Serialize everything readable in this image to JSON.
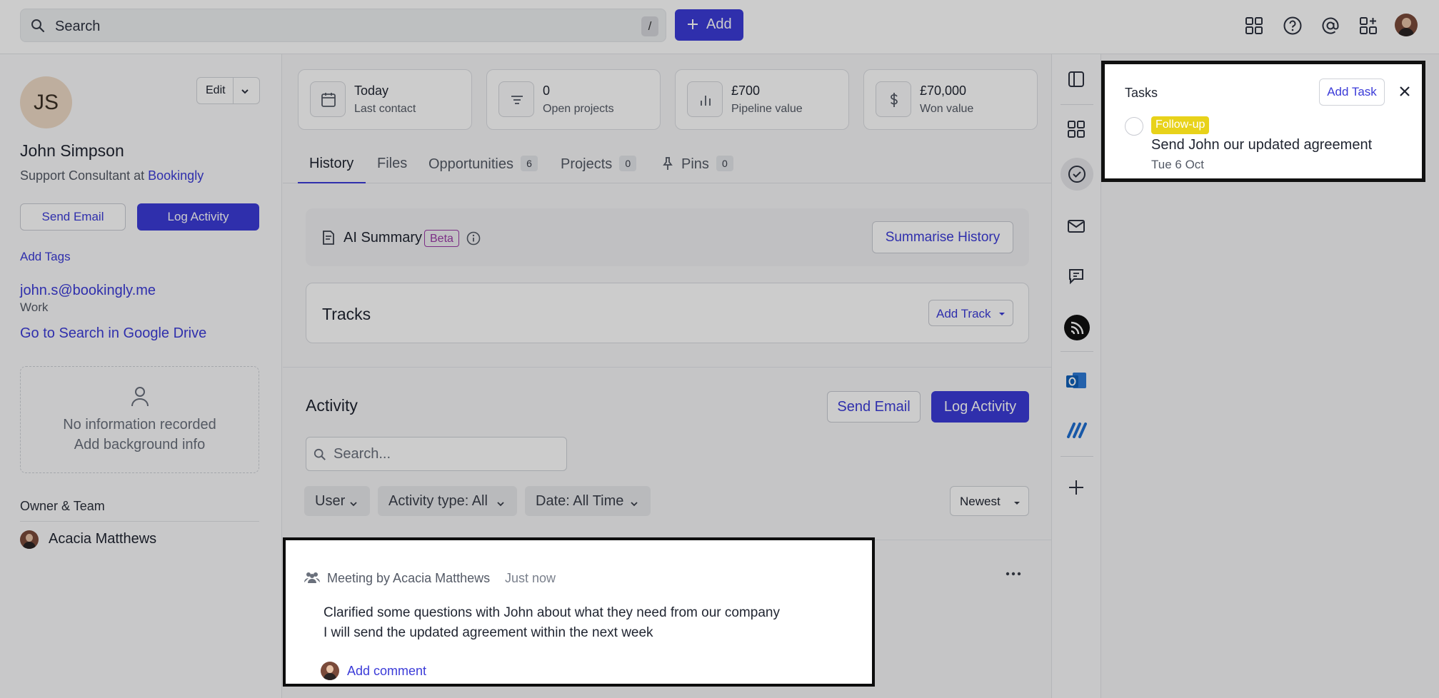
{
  "topbar": {
    "search_placeholder": "Search",
    "search_shortcut": "/",
    "add_label": "Add"
  },
  "contact": {
    "initials": "JS",
    "edit_label": "Edit",
    "name": "John Simpson",
    "role_prefix": "Support Consultant at",
    "company": "Bookingly",
    "send_email": "Send Email",
    "log_activity": "Log Activity",
    "add_tags": "Add Tags",
    "email": "john.s@bookingly.me",
    "email_type": "Work",
    "drive_link": "Go to Search in Google Drive",
    "no_info": "No information recorded",
    "add_background": "Add background info",
    "owner_heading": "Owner & Team",
    "owner_name": "Acacia Matthews"
  },
  "stats": [
    {
      "value": "Today",
      "label": "Last contact",
      "icon": "calendar-icon"
    },
    {
      "value": "0",
      "label": "Open projects",
      "icon": "list-icon"
    },
    {
      "value": "£700",
      "label": "Pipeline value",
      "icon": "bar-chart-icon"
    },
    {
      "value": "£70,000",
      "label": "Won value",
      "icon": "dollar-icon"
    }
  ],
  "tabs": [
    {
      "label": "History"
    },
    {
      "label": "Files"
    },
    {
      "label": "Opportunities",
      "count": "6"
    },
    {
      "label": "Projects",
      "count": "0"
    },
    {
      "label": "Pins",
      "count": "0"
    }
  ],
  "ai_summary": {
    "title": "AI Summary",
    "badge": "Beta",
    "button": "Summarise History"
  },
  "tracks": {
    "title": "Tracks",
    "add_track": "Add Track"
  },
  "activity": {
    "title": "Activity",
    "send_email": "Send Email",
    "log_activity": "Log Activity",
    "search_placeholder": "Search...",
    "filter_user": "User",
    "filter_type_label": "Activity type:",
    "filter_type_value": "All",
    "filter_date_label": "Date:",
    "filter_date_value": "All Time",
    "sort": "Newest"
  },
  "feed_item": {
    "meta": "Meeting by Acacia Matthews",
    "time": "Just now",
    "line1": "Clarified some questions with John about what they need from our company",
    "line2": "I will send the updated agreement within the next week",
    "add_comment": "Add comment"
  },
  "tasks": {
    "title": "Tasks",
    "add_task": "Add Task",
    "items": [
      {
        "tag": "Follow-up",
        "text": "Send John our updated agreement",
        "date": "Tue 6 Oct"
      }
    ]
  },
  "colors": {
    "accent": "#3b3bd8",
    "tag_yellow": "#e8d21a"
  }
}
